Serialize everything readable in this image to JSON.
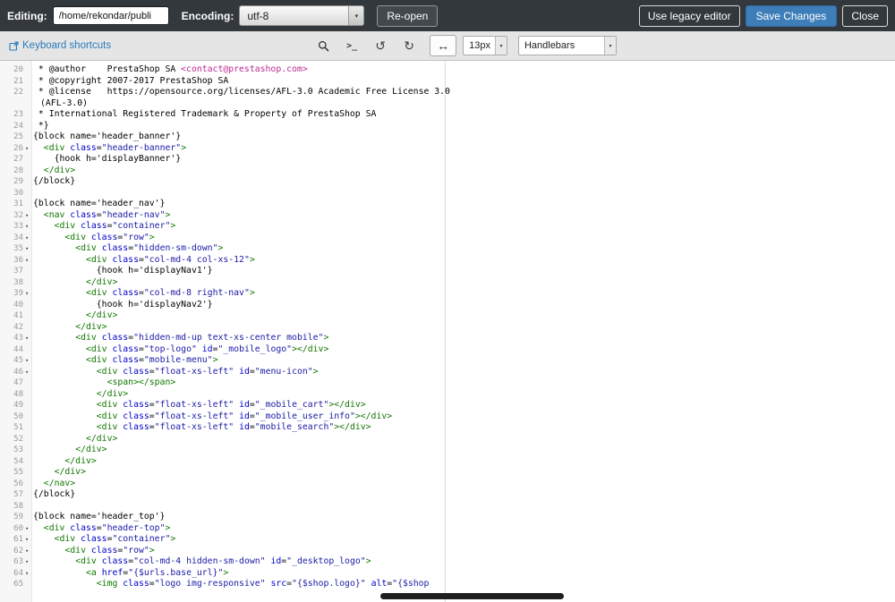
{
  "topbar": {
    "editing_label": "Editing:",
    "path_value": "/home/rekondar/publi",
    "encoding_label": "Encoding:",
    "encoding_value": "utf-8",
    "reopen_label": "Re-open",
    "legacy_label": "Use legacy editor",
    "save_label": "Save Changes",
    "close_label": "Close"
  },
  "toolbar": {
    "shortcuts_label": "Keyboard shortcuts",
    "terminal_glyph": ">_",
    "undo_glyph": "↺",
    "redo_glyph": "↻",
    "wrap_glyph": "↔",
    "dropdown_arrow": "▾",
    "font_size_value": "13px",
    "syntax_value": "Handlebars"
  },
  "colors": {
    "accent_blue": "#3d7eb8",
    "link_blue": "#2b7bb9",
    "tok_plain": "#000000",
    "tok_tag": "#117700",
    "tok_attr": "#0000cc",
    "tok_str": "#1a1aa6",
    "tok_email": "#bb2a93",
    "gutter_num": "#999999"
  },
  "editor": {
    "fold_glyph": "▾",
    "lines": [
      {
        "num": "20",
        "segs": [
          [
            " * @author    PrestaShop SA ",
            "p"
          ],
          [
            "<contact@prestashop.com>",
            "e"
          ]
        ]
      },
      {
        "num": "21",
        "segs": [
          [
            " * @copyright 2007-2017 PrestaShop SA",
            "p"
          ]
        ]
      },
      {
        "num": "22",
        "segs": [
          [
            " * @license   https://opensource.org/licenses/AFL-3.0 Academic Free License 3.0",
            "p"
          ]
        ]
      },
      {
        "num": "",
        "wrap": true,
        "segs": [
          [
            "(AFL-3.0)",
            "p"
          ]
        ]
      },
      {
        "num": "23",
        "segs": [
          [
            " * International Registered Trademark & Property of PrestaShop SA",
            "p"
          ]
        ]
      },
      {
        "num": "24",
        "segs": [
          [
            " *}",
            "p"
          ]
        ]
      },
      {
        "num": "25",
        "segs": [
          [
            "{block name='header_banner'}",
            "p"
          ]
        ]
      },
      {
        "num": "26",
        "fold": true,
        "segs": [
          [
            "  ",
            "p"
          ],
          [
            "<div",
            "t"
          ],
          [
            " ",
            "p"
          ],
          [
            "class",
            "a"
          ],
          [
            "=",
            "p"
          ],
          [
            "\"header-banner\"",
            "s"
          ],
          [
            ">",
            "t"
          ]
        ]
      },
      {
        "num": "27",
        "segs": [
          [
            "    {hook h='displayBanner'}",
            "p"
          ]
        ]
      },
      {
        "num": "28",
        "segs": [
          [
            "  ",
            "p"
          ],
          [
            "</div>",
            "t"
          ]
        ]
      },
      {
        "num": "29",
        "segs": [
          [
            "{/block}",
            "p"
          ]
        ]
      },
      {
        "num": "30",
        "segs": []
      },
      {
        "num": "31",
        "segs": [
          [
            "{block name='header_nav'}",
            "p"
          ]
        ]
      },
      {
        "num": "32",
        "fold": true,
        "segs": [
          [
            "  ",
            "p"
          ],
          [
            "<nav",
            "t"
          ],
          [
            " ",
            "p"
          ],
          [
            "class",
            "a"
          ],
          [
            "=",
            "p"
          ],
          [
            "\"header-nav\"",
            "s"
          ],
          [
            ">",
            "t"
          ]
        ]
      },
      {
        "num": "33",
        "fold": true,
        "segs": [
          [
            "    ",
            "p"
          ],
          [
            "<div",
            "t"
          ],
          [
            " ",
            "p"
          ],
          [
            "class",
            "a"
          ],
          [
            "=",
            "p"
          ],
          [
            "\"container\"",
            "s"
          ],
          [
            ">",
            "t"
          ]
        ]
      },
      {
        "num": "34",
        "fold": true,
        "segs": [
          [
            "      ",
            "p"
          ],
          [
            "<div",
            "t"
          ],
          [
            " ",
            "p"
          ],
          [
            "class",
            "a"
          ],
          [
            "=",
            "p"
          ],
          [
            "\"row\"",
            "s"
          ],
          [
            ">",
            "t"
          ]
        ]
      },
      {
        "num": "35",
        "fold": true,
        "segs": [
          [
            "        ",
            "p"
          ],
          [
            "<div",
            "t"
          ],
          [
            " ",
            "p"
          ],
          [
            "class",
            "a"
          ],
          [
            "=",
            "p"
          ],
          [
            "\"hidden-sm-down\"",
            "s"
          ],
          [
            ">",
            "t"
          ]
        ]
      },
      {
        "num": "36",
        "fold": true,
        "segs": [
          [
            "          ",
            "p"
          ],
          [
            "<div",
            "t"
          ],
          [
            " ",
            "p"
          ],
          [
            "class",
            "a"
          ],
          [
            "=",
            "p"
          ],
          [
            "\"col-md-4 col-xs-12\"",
            "s"
          ],
          [
            ">",
            "t"
          ]
        ]
      },
      {
        "num": "37",
        "segs": [
          [
            "            {hook h='displayNav1'}",
            "p"
          ]
        ]
      },
      {
        "num": "38",
        "segs": [
          [
            "          ",
            "p"
          ],
          [
            "</div>",
            "t"
          ]
        ]
      },
      {
        "num": "39",
        "fold": true,
        "segs": [
          [
            "          ",
            "p"
          ],
          [
            "<div",
            "t"
          ],
          [
            " ",
            "p"
          ],
          [
            "class",
            "a"
          ],
          [
            "=",
            "p"
          ],
          [
            "\"col-md-8 right-nav\"",
            "s"
          ],
          [
            ">",
            "t"
          ]
        ]
      },
      {
        "num": "40",
        "segs": [
          [
            "            {hook h='displayNav2'}",
            "p"
          ]
        ]
      },
      {
        "num": "41",
        "segs": [
          [
            "          ",
            "p"
          ],
          [
            "</div>",
            "t"
          ]
        ]
      },
      {
        "num": "42",
        "segs": [
          [
            "        ",
            "p"
          ],
          [
            "</div>",
            "t"
          ]
        ]
      },
      {
        "num": "43",
        "fold": true,
        "segs": [
          [
            "        ",
            "p"
          ],
          [
            "<div",
            "t"
          ],
          [
            " ",
            "p"
          ],
          [
            "class",
            "a"
          ],
          [
            "=",
            "p"
          ],
          [
            "\"hidden-md-up text-xs-center mobile\"",
            "s"
          ],
          [
            ">",
            "t"
          ]
        ]
      },
      {
        "num": "44",
        "segs": [
          [
            "          ",
            "p"
          ],
          [
            "<div",
            "t"
          ],
          [
            " ",
            "p"
          ],
          [
            "class",
            "a"
          ],
          [
            "=",
            "p"
          ],
          [
            "\"top-logo\"",
            "s"
          ],
          [
            " ",
            "p"
          ],
          [
            "id",
            "a"
          ],
          [
            "=",
            "p"
          ],
          [
            "\"_mobile_logo\"",
            "s"
          ],
          [
            ">",
            "t"
          ],
          [
            "</div>",
            "t"
          ]
        ]
      },
      {
        "num": "45",
        "fold": true,
        "segs": [
          [
            "          ",
            "p"
          ],
          [
            "<div",
            "t"
          ],
          [
            " ",
            "p"
          ],
          [
            "class",
            "a"
          ],
          [
            "=",
            "p"
          ],
          [
            "\"mobile-menu\"",
            "s"
          ],
          [
            ">",
            "t"
          ]
        ]
      },
      {
        "num": "46",
        "fold": true,
        "segs": [
          [
            "            ",
            "p"
          ],
          [
            "<div",
            "t"
          ],
          [
            " ",
            "p"
          ],
          [
            "class",
            "a"
          ],
          [
            "=",
            "p"
          ],
          [
            "\"float-xs-left\"",
            "s"
          ],
          [
            " ",
            "p"
          ],
          [
            "id",
            "a"
          ],
          [
            "=",
            "p"
          ],
          [
            "\"menu-icon\"",
            "s"
          ],
          [
            ">",
            "t"
          ]
        ]
      },
      {
        "num": "47",
        "segs": [
          [
            "              ",
            "p"
          ],
          [
            "<span>",
            "t"
          ],
          [
            "</span>",
            "t"
          ]
        ]
      },
      {
        "num": "48",
        "segs": [
          [
            "            ",
            "p"
          ],
          [
            "</div>",
            "t"
          ]
        ]
      },
      {
        "num": "49",
        "segs": [
          [
            "            ",
            "p"
          ],
          [
            "<div",
            "t"
          ],
          [
            " ",
            "p"
          ],
          [
            "class",
            "a"
          ],
          [
            "=",
            "p"
          ],
          [
            "\"float-xs-left\"",
            "s"
          ],
          [
            " ",
            "p"
          ],
          [
            "id",
            "a"
          ],
          [
            "=",
            "p"
          ],
          [
            "\"_mobile_cart\"",
            "s"
          ],
          [
            ">",
            "t"
          ],
          [
            "</div>",
            "t"
          ]
        ]
      },
      {
        "num": "50",
        "segs": [
          [
            "            ",
            "p"
          ],
          [
            "<div",
            "t"
          ],
          [
            " ",
            "p"
          ],
          [
            "class",
            "a"
          ],
          [
            "=",
            "p"
          ],
          [
            "\"float-xs-left\"",
            "s"
          ],
          [
            " ",
            "p"
          ],
          [
            "id",
            "a"
          ],
          [
            "=",
            "p"
          ],
          [
            "\"_mobile_user_info\"",
            "s"
          ],
          [
            ">",
            "t"
          ],
          [
            "</div>",
            "t"
          ]
        ]
      },
      {
        "num": "51",
        "segs": [
          [
            "            ",
            "p"
          ],
          [
            "<div",
            "t"
          ],
          [
            " ",
            "p"
          ],
          [
            "class",
            "a"
          ],
          [
            "=",
            "p"
          ],
          [
            "\"float-xs-left\"",
            "s"
          ],
          [
            " ",
            "p"
          ],
          [
            "id",
            "a"
          ],
          [
            "=",
            "p"
          ],
          [
            "\"mobile_search\"",
            "s"
          ],
          [
            ">",
            "t"
          ],
          [
            "</div>",
            "t"
          ]
        ]
      },
      {
        "num": "52",
        "segs": [
          [
            "          ",
            "p"
          ],
          [
            "</div>",
            "t"
          ]
        ]
      },
      {
        "num": "53",
        "segs": [
          [
            "        ",
            "p"
          ],
          [
            "</div>",
            "t"
          ]
        ]
      },
      {
        "num": "54",
        "segs": [
          [
            "      ",
            "p"
          ],
          [
            "</div>",
            "t"
          ]
        ]
      },
      {
        "num": "55",
        "segs": [
          [
            "    ",
            "p"
          ],
          [
            "</div>",
            "t"
          ]
        ]
      },
      {
        "num": "56",
        "segs": [
          [
            "  ",
            "p"
          ],
          [
            "</nav>",
            "t"
          ]
        ]
      },
      {
        "num": "57",
        "segs": [
          [
            "{/block}",
            "p"
          ]
        ]
      },
      {
        "num": "58",
        "segs": []
      },
      {
        "num": "59",
        "segs": [
          [
            "{block name='header_top'}",
            "p"
          ]
        ]
      },
      {
        "num": "60",
        "fold": true,
        "segs": [
          [
            "  ",
            "p"
          ],
          [
            "<div",
            "t"
          ],
          [
            " ",
            "p"
          ],
          [
            "class",
            "a"
          ],
          [
            "=",
            "p"
          ],
          [
            "\"header-top\"",
            "s"
          ],
          [
            ">",
            "t"
          ]
        ]
      },
      {
        "num": "61",
        "fold": true,
        "segs": [
          [
            "    ",
            "p"
          ],
          [
            "<div",
            "t"
          ],
          [
            " ",
            "p"
          ],
          [
            "class",
            "a"
          ],
          [
            "=",
            "p"
          ],
          [
            "\"container\"",
            "s"
          ],
          [
            ">",
            "t"
          ]
        ]
      },
      {
        "num": "62",
        "fold": true,
        "segs": [
          [
            "      ",
            "p"
          ],
          [
            "<div",
            "t"
          ],
          [
            " ",
            "p"
          ],
          [
            "class",
            "a"
          ],
          [
            "=",
            "p"
          ],
          [
            "\"row\"",
            "s"
          ],
          [
            ">",
            "t"
          ]
        ]
      },
      {
        "num": "63",
        "fold": true,
        "segs": [
          [
            "        ",
            "p"
          ],
          [
            "<div",
            "t"
          ],
          [
            " ",
            "p"
          ],
          [
            "class",
            "a"
          ],
          [
            "=",
            "p"
          ],
          [
            "\"col-md-4 hidden-sm-down\"",
            "s"
          ],
          [
            " ",
            "p"
          ],
          [
            "id",
            "a"
          ],
          [
            "=",
            "p"
          ],
          [
            "\"_desktop_logo\"",
            "s"
          ],
          [
            ">",
            "t"
          ]
        ]
      },
      {
        "num": "64",
        "fold": true,
        "segs": [
          [
            "          ",
            "p"
          ],
          [
            "<a",
            "t"
          ],
          [
            " ",
            "p"
          ],
          [
            "href",
            "a"
          ],
          [
            "=",
            "p"
          ],
          [
            "\"{$urls.base_url}\"",
            "s"
          ],
          [
            ">",
            "t"
          ]
        ]
      },
      {
        "num": "65",
        "segs": [
          [
            "            ",
            "p"
          ],
          [
            "<img",
            "t"
          ],
          [
            " ",
            "p"
          ],
          [
            "class",
            "a"
          ],
          [
            "=",
            "p"
          ],
          [
            "\"logo img-responsive\"",
            "s"
          ],
          [
            " ",
            "p"
          ],
          [
            "src",
            "a"
          ],
          [
            "=",
            "p"
          ],
          [
            "\"{$shop.logo}\"",
            "s"
          ],
          [
            " ",
            "p"
          ],
          [
            "alt",
            "a"
          ],
          [
            "=",
            "p"
          ],
          [
            "\"{$shop",
            "s"
          ]
        ]
      }
    ]
  }
}
